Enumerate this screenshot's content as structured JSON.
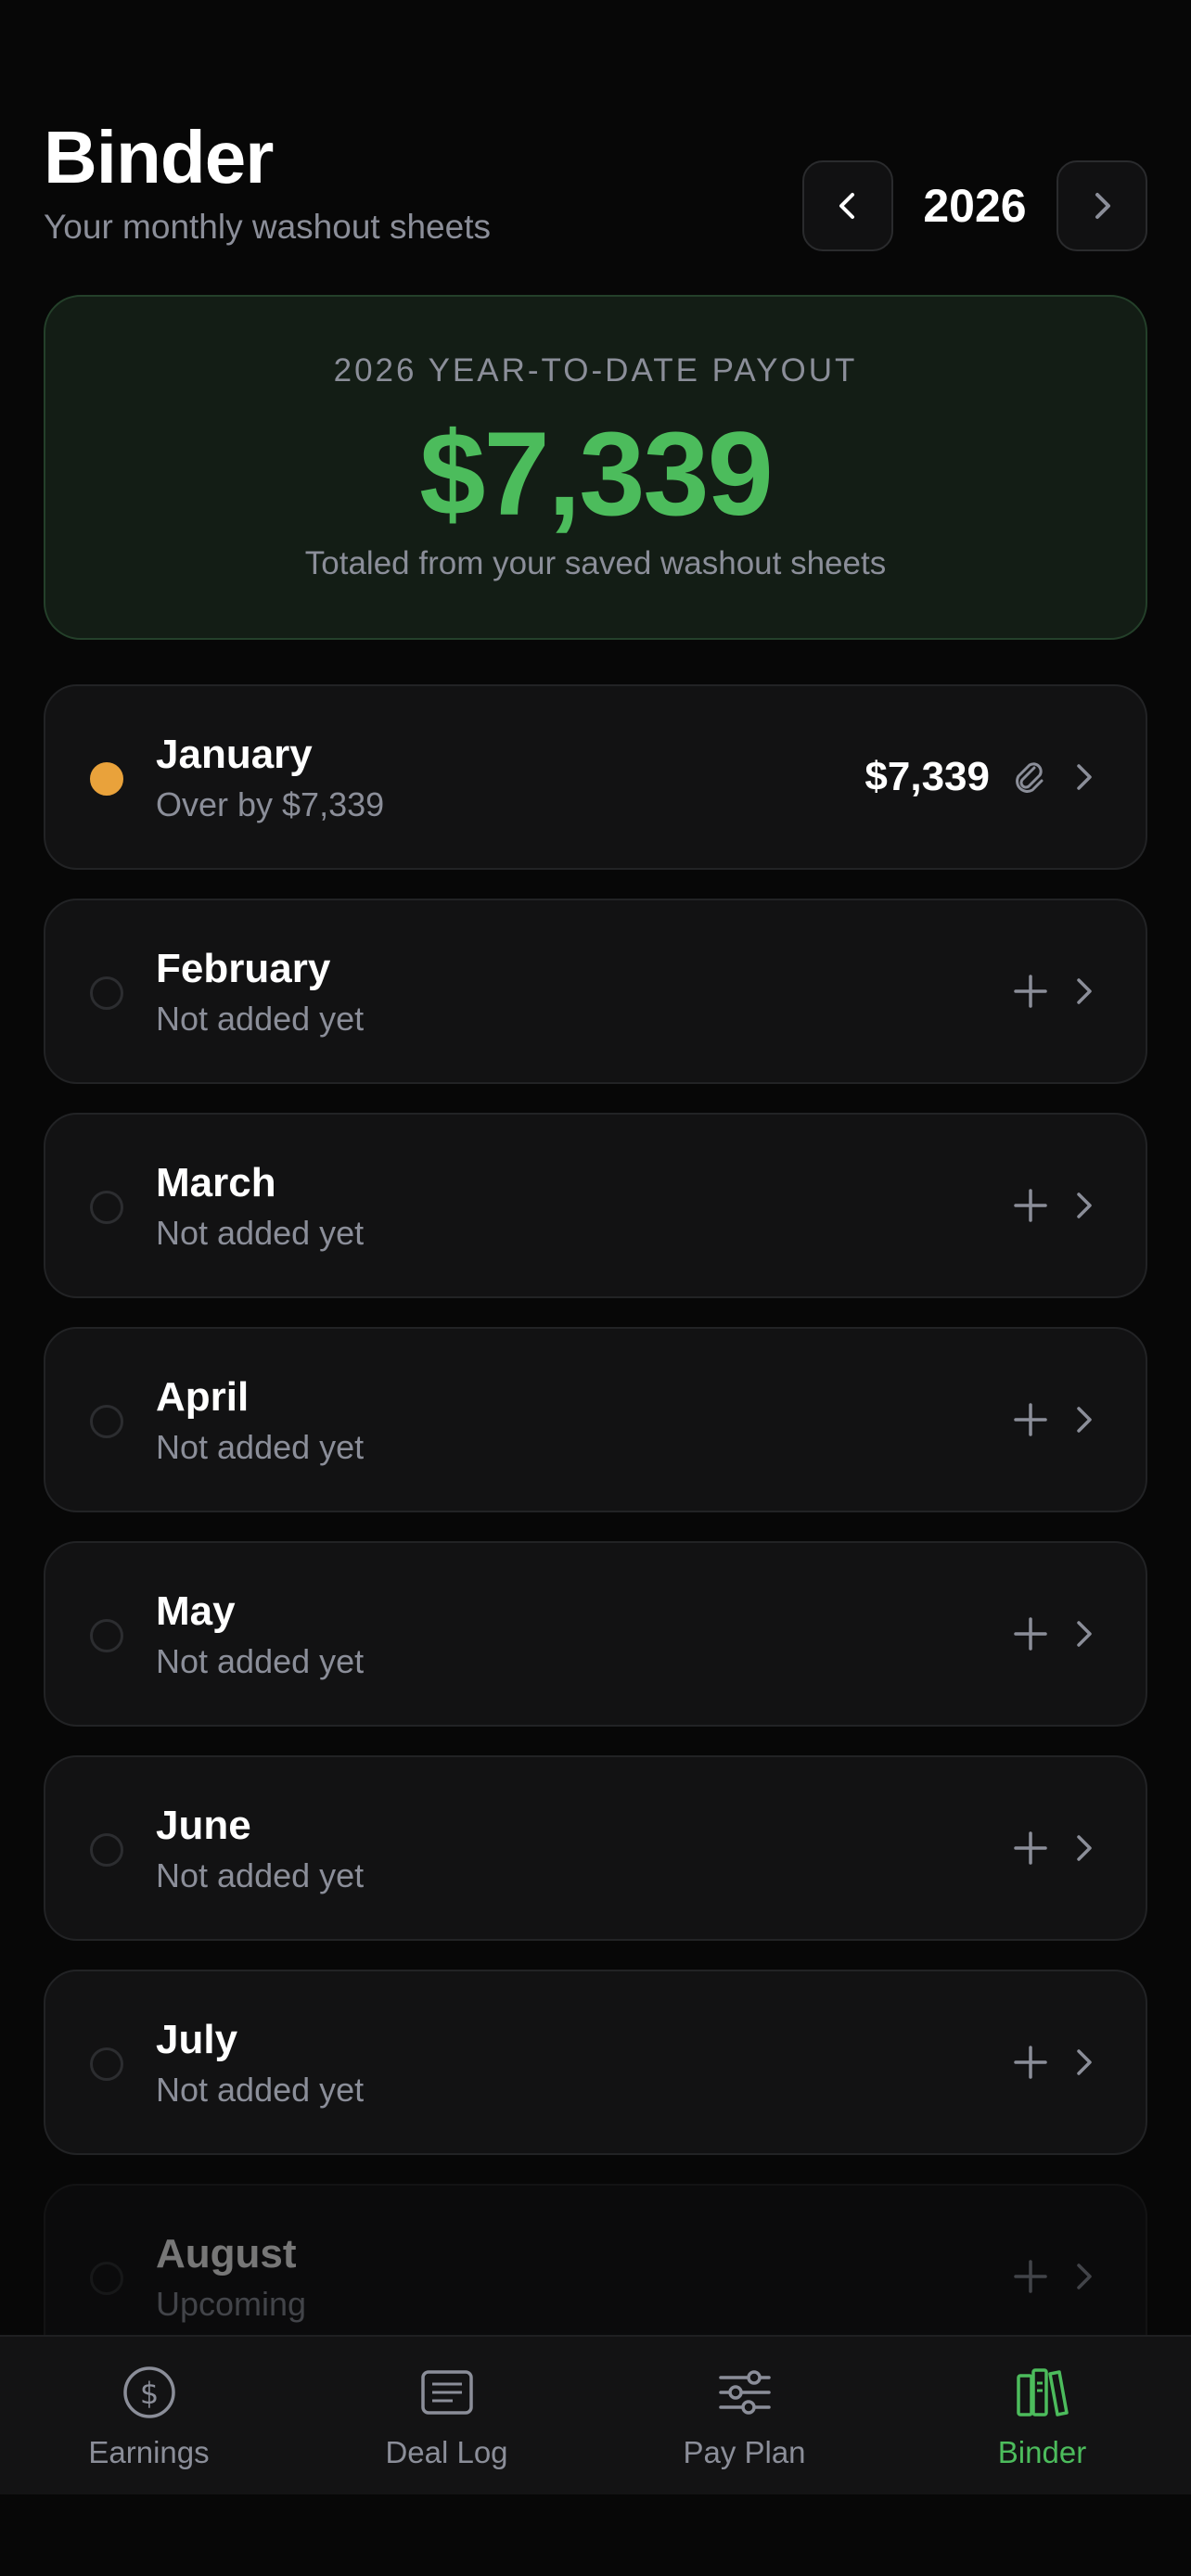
{
  "header": {
    "title": "Binder",
    "subtitle": "Your monthly washout sheets",
    "year": "2026"
  },
  "summary": {
    "label": "2026 YEAR-TO-DATE PAYOUT",
    "amount": "$7,339",
    "note": "Totaled from your saved washout sheets"
  },
  "months": [
    {
      "name": "January",
      "status": "Over by $7,339",
      "amount": "$7,339",
      "state": "saved"
    },
    {
      "name": "February",
      "status": "Not added yet",
      "state": "empty"
    },
    {
      "name": "March",
      "status": "Not added yet",
      "state": "empty"
    },
    {
      "name": "April",
      "status": "Not added yet",
      "state": "empty"
    },
    {
      "name": "May",
      "status": "Not added yet",
      "state": "empty"
    },
    {
      "name": "June",
      "status": "Not added yet",
      "state": "empty"
    },
    {
      "name": "July",
      "status": "Not added yet",
      "state": "empty"
    },
    {
      "name": "August",
      "status": "Upcoming",
      "state": "upcoming"
    }
  ],
  "tabs": [
    {
      "label": "Earnings",
      "icon": "dollar-circle-icon",
      "active": false
    },
    {
      "label": "Deal Log",
      "icon": "receipt-list-icon",
      "active": false
    },
    {
      "label": "Pay Plan",
      "icon": "sliders-icon",
      "active": false
    },
    {
      "label": "Binder",
      "icon": "books-icon",
      "active": true
    }
  ],
  "colors": {
    "accent_green": "#4cbc5c",
    "status_orange": "#e9a23b",
    "muted_text": "#8b8e99",
    "background": "#070707"
  }
}
